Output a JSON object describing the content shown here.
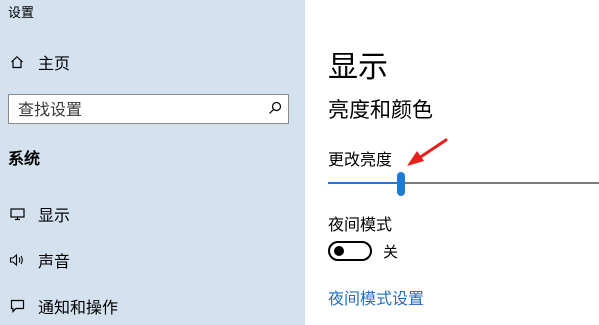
{
  "app": {
    "title": "设置"
  },
  "sidebar": {
    "home": {
      "label": "主页",
      "icon": "home-icon"
    },
    "search": {
      "placeholder": "查找设置",
      "icon": "search-icon"
    },
    "section": "系统",
    "items": [
      {
        "label": "显示",
        "icon": "monitor-icon"
      },
      {
        "label": "声音",
        "icon": "speaker-icon"
      },
      {
        "label": "通知和操作",
        "icon": "notification-icon"
      }
    ]
  },
  "main": {
    "title": "显示",
    "subtitle": "亮度和颜色",
    "brightness": {
      "label": "更改亮度",
      "value": 0.27
    },
    "night_light": {
      "label": "夜间模式",
      "state": "关",
      "on": false,
      "settings_link": "夜间模式设置"
    }
  },
  "colors": {
    "sidebar_bg": "#d3e2ee",
    "accent": "#1f7ad1",
    "annotation_arrow": "#e8201c"
  }
}
